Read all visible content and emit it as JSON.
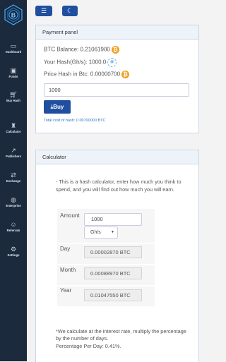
{
  "sidebar": {
    "items": [
      {
        "label": "Dashboard",
        "icon": "monitor-icon"
      },
      {
        "label": "Funds",
        "icon": "wallet-icon"
      },
      {
        "label": "Buy Hash",
        "icon": "cart-icon"
      },
      {
        "label": "Calculator",
        "icon": "trophy-icon"
      },
      {
        "label": "Publishers",
        "icon": "chart-icon"
      },
      {
        "label": "Exchange",
        "icon": "exchange-icon"
      },
      {
        "label": "Enterprise",
        "icon": "globe-icon"
      },
      {
        "label": "Referrals",
        "icon": "person-icon"
      },
      {
        "label": "Settings",
        "icon": "gear-icon"
      }
    ]
  },
  "topbar": {
    "menu_icon": "☰",
    "theme_icon": "☾"
  },
  "payment": {
    "title": "Payment panel",
    "btc_balance": "BTC Balance: 0.21061900",
    "hash_label": "Your Hash(Gh/s): 1000.0",
    "price_label": "Price Hash in Btc: 0.00000700",
    "amount_value": "1000",
    "buy_label": "Buy",
    "total_cost": "Total cost of hash: 0.00700000 BTC"
  },
  "calculator": {
    "title": "Calculator",
    "intro": "- This is a hash calculator, enter how much you think to spend, and you will find out how much you will earn.",
    "amount_label": "Amount",
    "amount_value": "1000",
    "unit_value": "Gh/s",
    "day_label": "Day",
    "day_value": "0.00002870 BTC",
    "month_label": "Month",
    "month_value": "0.00088970 BTC",
    "year_label": "Year",
    "year_value": "0.01047550 BTC",
    "note": "*We calculate at the interest rate, multiply the percentage by the number of days.",
    "percentage": "Percentage Per Day: 0.41%."
  },
  "colors": {
    "sidebar": "#1b2a3d",
    "accent": "#1f4f9e",
    "coin": "#f49d1c"
  }
}
